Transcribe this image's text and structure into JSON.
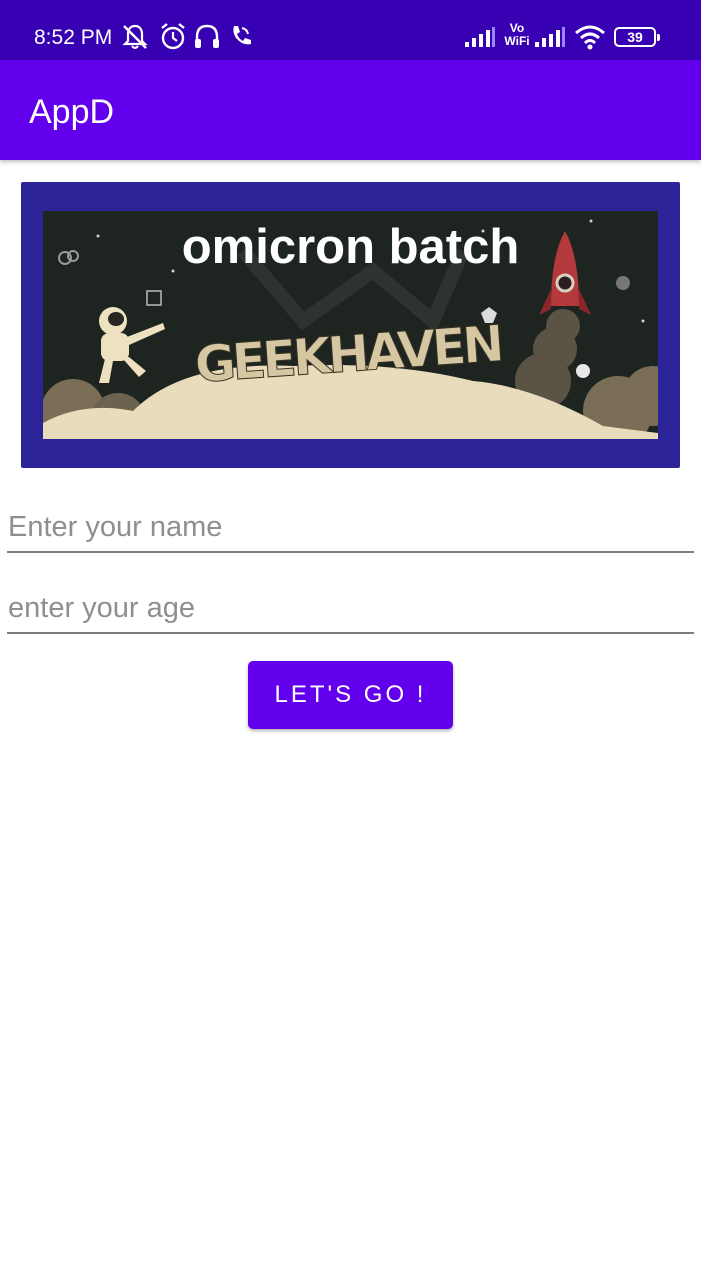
{
  "status_bar": {
    "time": "8:52 PM",
    "icons": [
      "notifications-off-icon",
      "alarm-icon",
      "headphones-icon",
      "wifi-calling-icon",
      "signal-icon",
      "vowifi-icon",
      "signal-icon",
      "wifi-icon",
      "battery-icon"
    ],
    "vowifi_top": "Vo",
    "vowifi_bottom": "WiFi",
    "battery": "39"
  },
  "app_bar": {
    "title": "AppD",
    "color": "#6200ee"
  },
  "banner": {
    "caption": "omicron batch",
    "image_text": "GEEKHAVEN",
    "frame_color": "#2c2399"
  },
  "form": {
    "name_placeholder": "Enter your name",
    "age_placeholder": "enter your age",
    "name_value": "",
    "age_value": ""
  },
  "button": {
    "label": "LET'S GO !",
    "color": "#6200ee"
  }
}
